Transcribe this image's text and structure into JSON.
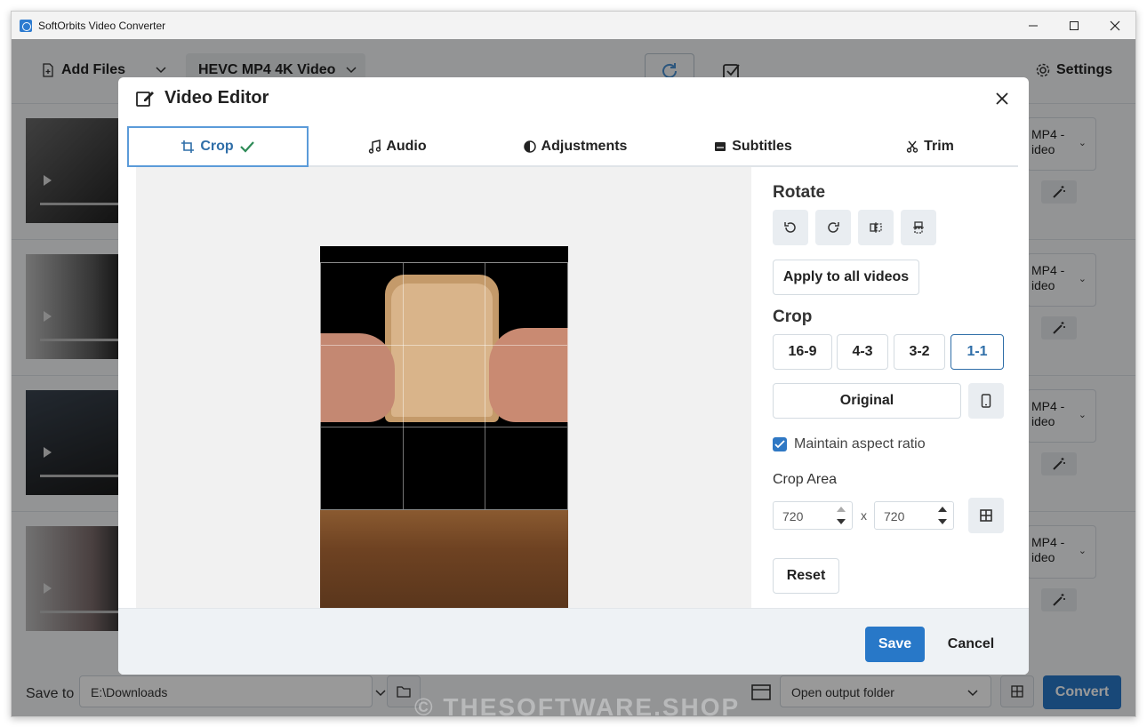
{
  "window": {
    "title": "SoftOrbits Video Converter"
  },
  "toolbar": {
    "add_files": "Add Files",
    "format": "HEVC MP4 4K Video",
    "settings": "Settings"
  },
  "rows": [
    {
      "format_line1": "MP4 -",
      "format_line2": "ideo"
    },
    {
      "format_line1": "MP4 -",
      "format_line2": "ideo"
    },
    {
      "format_line1": "MP4 -",
      "format_line2": "ideo"
    },
    {
      "format_line1": "MP4 -",
      "format_line2": "ideo"
    }
  ],
  "bottom": {
    "save_to_label": "Save to",
    "save_path": "E:\\Downloads",
    "output_option": "Open output folder",
    "convert": "Convert"
  },
  "editor": {
    "title": "Video Editor",
    "tabs": [
      {
        "label": "Crop",
        "icon": "crop-icon"
      },
      {
        "label": "Audio",
        "icon": "music-icon"
      },
      {
        "label": "Adjustments",
        "icon": "contrast-icon"
      },
      {
        "label": "Subtitles",
        "icon": "subtitles-icon"
      },
      {
        "label": "Trim",
        "icon": "scissors-icon"
      }
    ],
    "rotate_title": "Rotate",
    "apply_all": "Apply to all videos",
    "crop_title": "Crop",
    "ratios": [
      "16-9",
      "4-3",
      "3-2",
      "1-1"
    ],
    "selected_ratio": "1-1",
    "original": "Original",
    "maintain_aspect": "Maintain aspect ratio",
    "maintain_checked": true,
    "crop_area_label": "Crop Area",
    "crop_width": "720",
    "crop_height": "720",
    "x_sep": "x",
    "reset": "Reset",
    "save": "Save",
    "cancel": "Cancel"
  },
  "watermark": "© THESOFTWARE.SHOP",
  "colors": {
    "accent": "#2878c8",
    "active_tab_border": "#5b9bd9",
    "check_green": "#2e8b57"
  }
}
